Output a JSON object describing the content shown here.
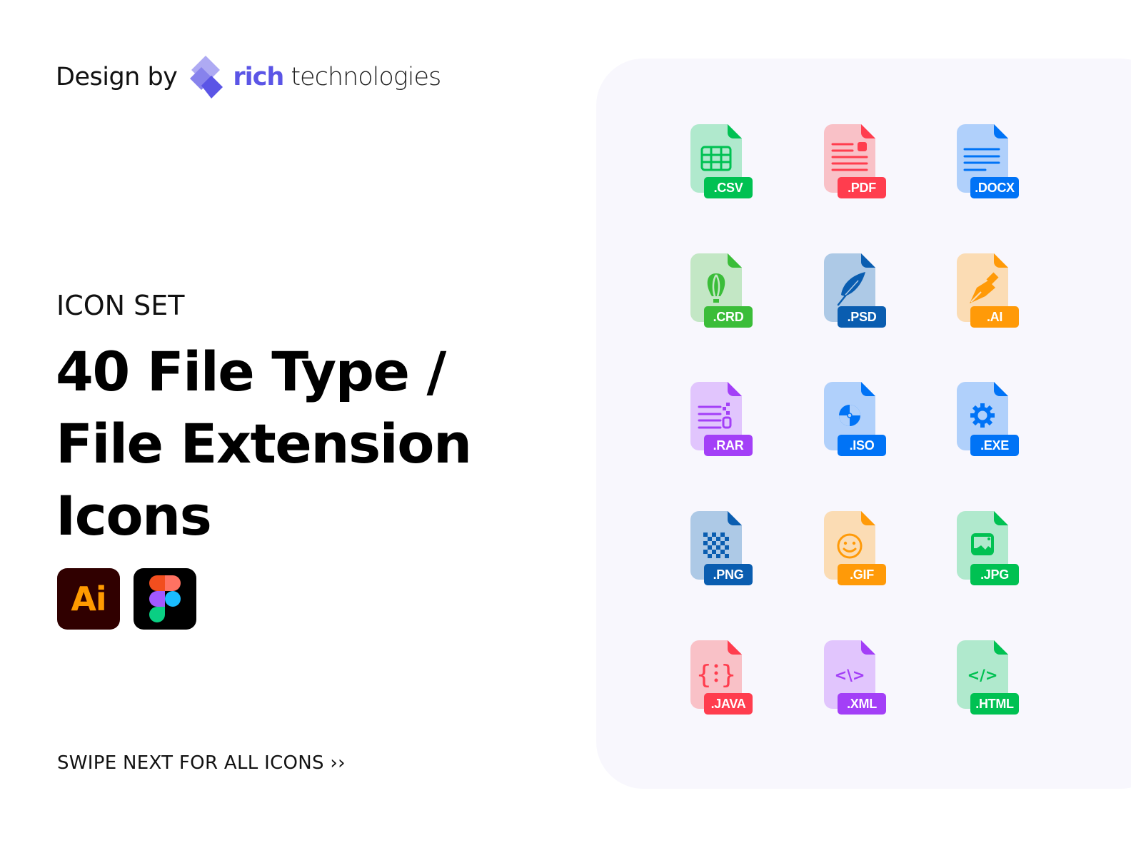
{
  "brand": {
    "prefix": "Design by",
    "name_bold": "rich",
    "name_light": "technologies",
    "color": "#5b55e6"
  },
  "hero": {
    "subtitle": "ICON SET",
    "title_lines": [
      "40 File Type /",
      "File Extension",
      "Icons"
    ]
  },
  "tools": [
    {
      "name": "Adobe Illustrator",
      "label": "Ai"
    },
    {
      "name": "Figma",
      "label": ""
    }
  ],
  "footer": {
    "cta": "SWIPE NEXT FOR ALL ICONS ››"
  },
  "icons": [
    {
      "label": ".CSV",
      "glyph": "table-icon",
      "light": "#b0e9cd",
      "dark": "#00c152"
    },
    {
      "label": ".PDF",
      "glyph": "document-image-icon",
      "light": "#f9c1c7",
      "dark": "#ff3d4e"
    },
    {
      "label": ".DOCX",
      "glyph": "text-lines-icon",
      "light": "#b0d0fb",
      "dark": "#0073f6"
    },
    {
      "label": ".CRD",
      "glyph": "balloon-icon",
      "light": "#c3e7c5",
      "dark": "#3bbd39"
    },
    {
      "label": ".PSD",
      "glyph": "feather-icon",
      "light": "#adc9e6",
      "dark": "#0a5db0"
    },
    {
      "label": ".AI",
      "glyph": "pen-nib-icon",
      "light": "#fbdcb4",
      "dark": "#ff9a08"
    },
    {
      "label": ".RAR",
      "glyph": "zip-icon",
      "light": "#e1c5fd",
      "dark": "#a33ff7"
    },
    {
      "label": ".ISO",
      "glyph": "disc-icon",
      "light": "#b0d0fb",
      "dark": "#0073f6"
    },
    {
      "label": ".EXE",
      "glyph": "gear-icon",
      "light": "#b0d0fb",
      "dark": "#0073f6"
    },
    {
      "label": ".PNG",
      "glyph": "checker-icon",
      "light": "#adc9e6",
      "dark": "#0a5db0"
    },
    {
      "label": ".GIF",
      "glyph": "smiley-icon",
      "light": "#fbdcb4",
      "dark": "#ff9a08"
    },
    {
      "label": ".JPG",
      "glyph": "picture-icon",
      "light": "#b0e9cd",
      "dark": "#00c152"
    },
    {
      "label": ".JAVA",
      "glyph": "braces-icon",
      "light": "#f9c1c7",
      "dark": "#ff3d4e"
    },
    {
      "label": ".XML",
      "glyph": "code-backslash-icon",
      "light": "#e1c5fd",
      "dark": "#a33ff7"
    },
    {
      "label": ".HTML",
      "glyph": "code-slash-icon",
      "light": "#b0e9cd",
      "dark": "#00c152"
    }
  ]
}
